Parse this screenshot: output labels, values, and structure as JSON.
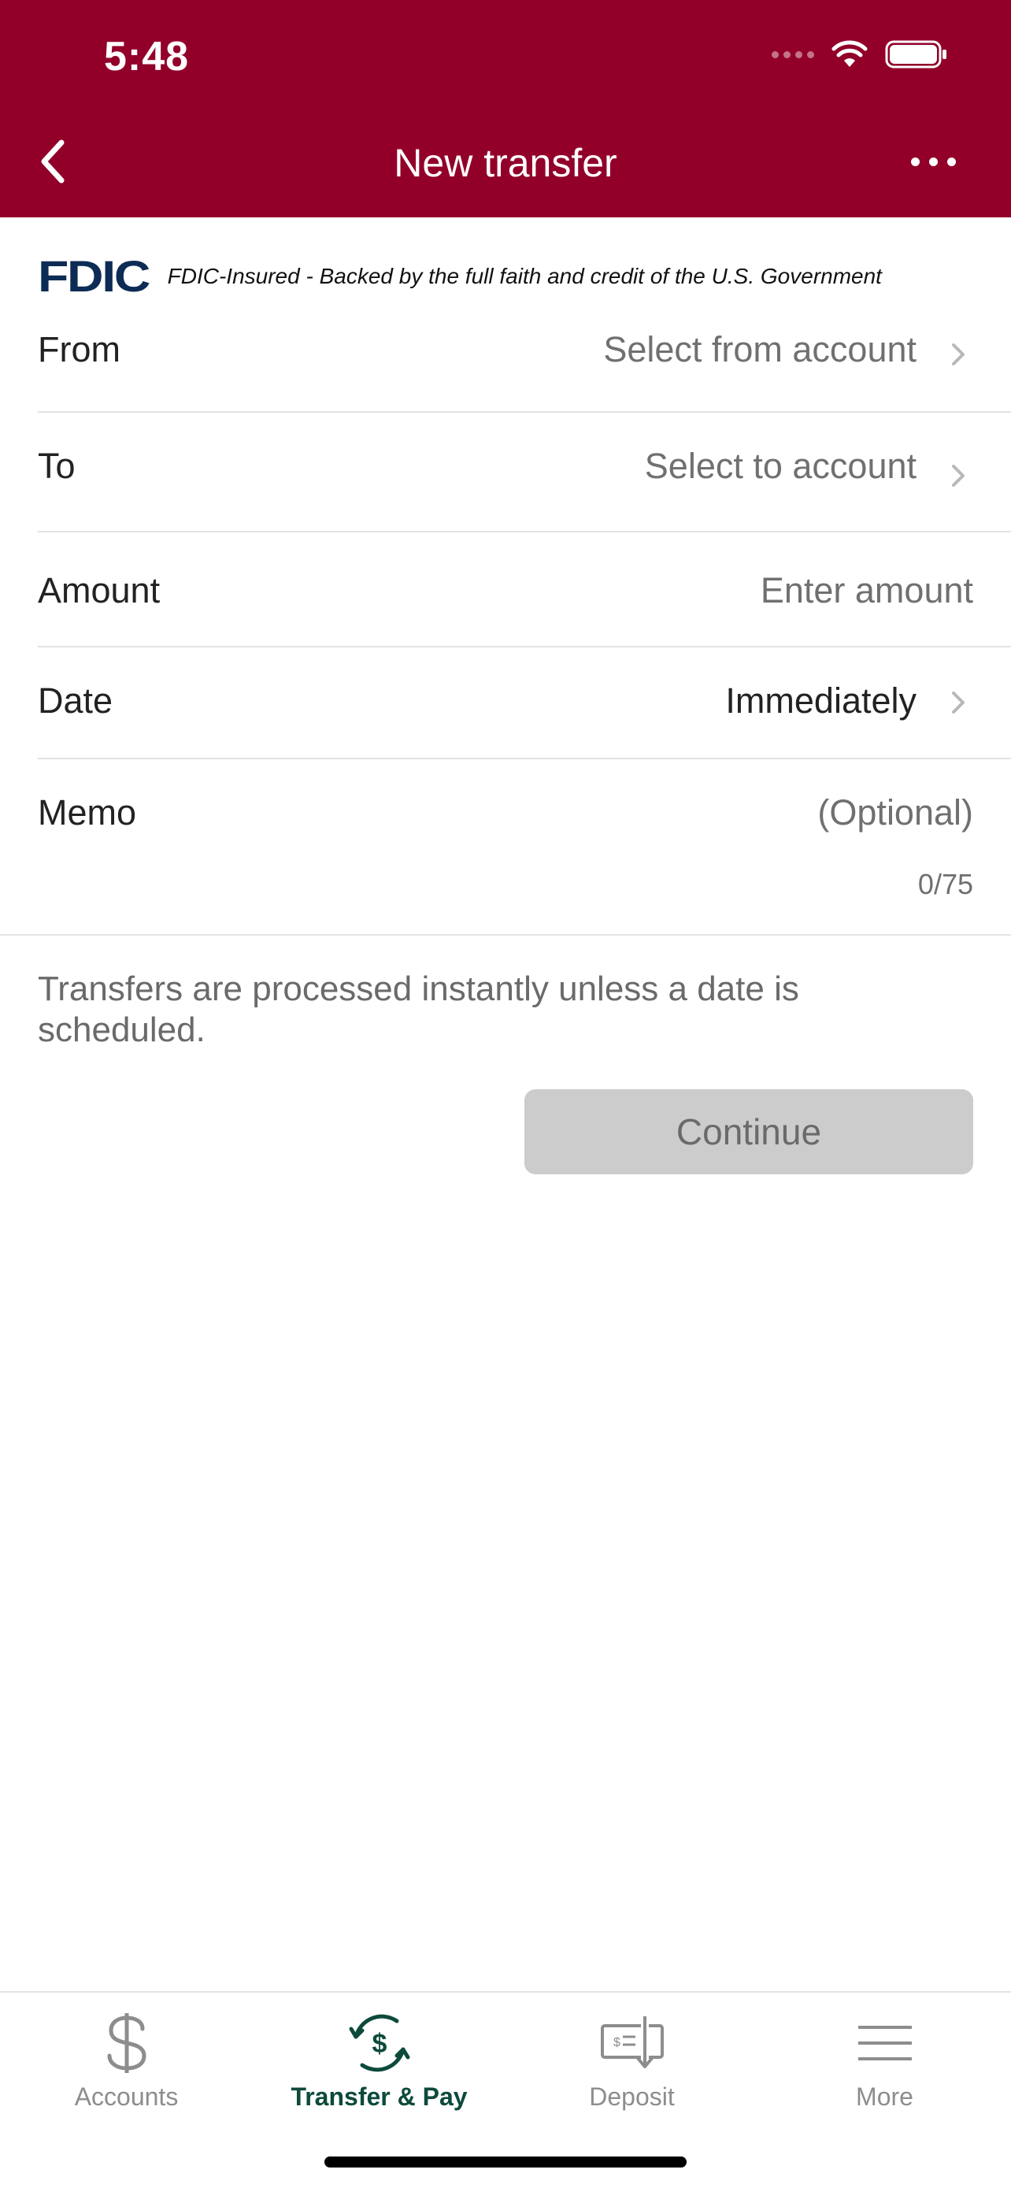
{
  "status_bar": {
    "time": "5:48"
  },
  "header": {
    "title": "New transfer"
  },
  "fdic": {
    "logo": "FDIC",
    "text": "FDIC-Insured - Backed by the full faith and credit of the U.S. Government"
  },
  "form": {
    "from": {
      "label": "From",
      "value": "Select from account"
    },
    "to": {
      "label": "To",
      "value": "Select to account"
    },
    "amount": {
      "label": "Amount",
      "placeholder": "Enter amount"
    },
    "date": {
      "label": "Date",
      "value": "Immediately"
    },
    "memo": {
      "label": "Memo",
      "placeholder": "(Optional)",
      "count": "0/75"
    }
  },
  "info_text": "Transfers are processed instantly unless a date is scheduled.",
  "continue_label": "Continue",
  "tabs": [
    {
      "label": "Accounts",
      "icon": "dollar-icon",
      "active": false
    },
    {
      "label": "Transfer & Pay",
      "icon": "transfer-dollar-icon",
      "active": true
    },
    {
      "label": "Deposit",
      "icon": "check-deposit-icon",
      "active": false
    },
    {
      "label": "More",
      "icon": "hamburger-icon",
      "active": false
    }
  ],
  "colors": {
    "header": "#92002a",
    "active_tab": "#0d4a3c",
    "button_disabled": "#cccccc",
    "fdic_logo": "#0c2c56"
  }
}
